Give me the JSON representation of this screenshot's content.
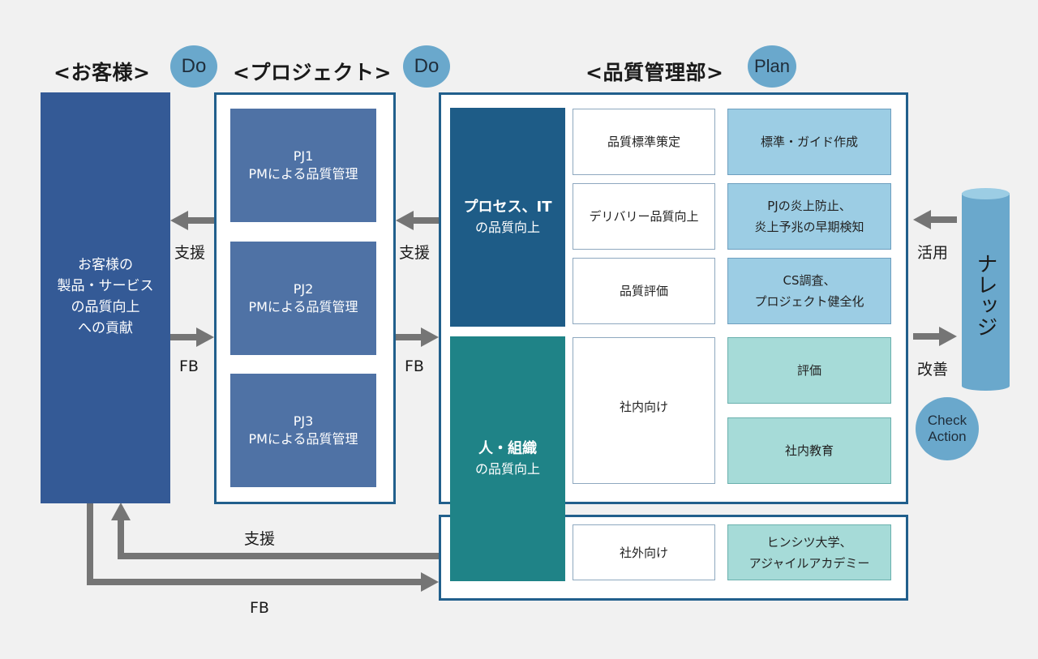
{
  "headers": {
    "customer": "<お客様>",
    "project": "<プロジェクト>",
    "qa_dept": "<品質管理部>"
  },
  "badges": {
    "customer": "Do",
    "project": "Do",
    "qa_dept": "Plan",
    "knowledge": [
      "Check",
      "Action"
    ]
  },
  "customer_box": {
    "lines": [
      "お客様の",
      "製品・サービス",
      "の品質向上",
      "への貢献"
    ]
  },
  "projects": [
    {
      "id": "PJ1",
      "label": "PMによる品質管理"
    },
    {
      "id": "PJ2",
      "label": "PMによる品質管理"
    },
    {
      "id": "PJ3",
      "label": "PMによる品質管理"
    }
  ],
  "qa": {
    "process_block": {
      "title": "プロセス、IT",
      "subtitle": "の品質向上"
    },
    "people_block": {
      "title": "人・組織",
      "subtitle": "の品質向上"
    },
    "process_rows": [
      {
        "activity": "品質標準策定",
        "output": [
          "標準・ガイド作成"
        ]
      },
      {
        "activity": "デリバリー品質向上",
        "output": [
          "PJの炎上防止、",
          "炎上予兆の早期検知"
        ]
      },
      {
        "activity": "品質評価",
        "output": [
          "CS調査、",
          "プロジェクト健全化"
        ]
      }
    ],
    "internal": {
      "activity": "社内向け",
      "outputs": [
        "評価",
        "社内教育"
      ]
    },
    "external": {
      "activity": "社外向け",
      "output": [
        "ヒンシツ大学、",
        "アジャイルアカデミー"
      ]
    }
  },
  "knowledge": {
    "label": "ナレッジ"
  },
  "arrow_labels": {
    "customer_support": "支援",
    "customer_fb": "FB",
    "project_support": "支援",
    "project_fb": "FB",
    "knowledge_use": "活用",
    "knowledge_improve": "改善",
    "bottom_support": "支援",
    "bottom_fb": "FB"
  },
  "colors": {
    "background": "#f1f1f1",
    "customer_box": "#345a96",
    "project_box": "#4f72a5",
    "frame": "#215f8c",
    "process_block": "#1e5c87",
    "people_block": "#1f8387",
    "output_blue": "#9ccde4",
    "output_teal": "#a6dbd8",
    "badge": "#6aa8cc",
    "arrow": "#757575"
  }
}
